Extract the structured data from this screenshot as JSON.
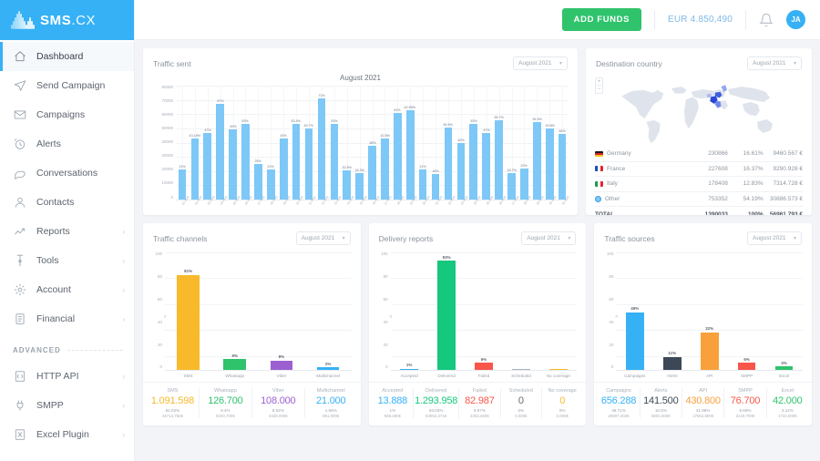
{
  "brand": {
    "name": "SMS",
    "suffix": ".CX"
  },
  "sidebar": {
    "items": [
      {
        "label": "Dashboard",
        "icon": "home-icon",
        "chevron": ""
      },
      {
        "label": "Send Campaign",
        "icon": "send-icon",
        "chevron": ""
      },
      {
        "label": "Campaigns",
        "icon": "envelope-icon",
        "chevron": ""
      },
      {
        "label": "Alerts",
        "icon": "alarm-clock-icon",
        "chevron": ""
      },
      {
        "label": "Conversations",
        "icon": "chat-bubble-icon",
        "chevron": ""
      },
      {
        "label": "Contacts",
        "icon": "user-icon",
        "chevron": ""
      },
      {
        "label": "Reports",
        "icon": "trend-line-icon",
        "chevron": "›"
      },
      {
        "label": "Tools",
        "icon": "wrench-icon",
        "chevron": "›"
      },
      {
        "label": "Account",
        "icon": "gear-icon",
        "chevron": "›"
      },
      {
        "label": "Financial",
        "icon": "document-list-icon",
        "chevron": "›"
      }
    ],
    "section_label": "ADVANCED",
    "advanced_items": [
      {
        "label": "HTTP API",
        "icon": "code-file-icon",
        "chevron": "›"
      },
      {
        "label": "SMPP",
        "icon": "plug-icon",
        "chevron": "›"
      },
      {
        "label": "Excel Plugin",
        "icon": "excel-file-icon",
        "chevron": "›"
      }
    ]
  },
  "topbar": {
    "add_funds_label": "ADD FUNDS",
    "balance": "EUR 4.850,490",
    "bell_icon": "bell-icon",
    "avatar_initials": "JA"
  },
  "period": "August 2021",
  "cards": {
    "traffic_sent": {
      "title": "Traffic sent"
    },
    "destination_country": {
      "title": "Destination country"
    },
    "traffic_channels": {
      "title": "Traffic channels"
    },
    "delivery_reports": {
      "title": "Delivery reports"
    },
    "traffic_sources": {
      "title": "Traffic sources"
    }
  },
  "country_table": {
    "rows": [
      {
        "name": "Germany",
        "flag": "de",
        "count": "230866",
        "pct": "16.61%",
        "amount": "9460.567 €"
      },
      {
        "name": "France",
        "flag": "fr",
        "count": "227608",
        "pct": "16.37%",
        "amount": "9290.928 €"
      },
      {
        "name": "Italy",
        "flag": "it",
        "count": "178408",
        "pct": "12.83%",
        "amount": "7314.728 €"
      },
      {
        "name": "Other",
        "flag": "dot",
        "count": "753352",
        "pct": "54.19%",
        "amount": "30886.573 €"
      }
    ],
    "total": {
      "name": "TOTAL",
      "count": "1390033",
      "pct": "100%",
      "amount": "56961,793 €"
    }
  },
  "chart_data": [
    {
      "type": "bar",
      "name": "traffic-sent",
      "title": "August 2021",
      "xlabel": "",
      "ylabel": "",
      "ylim": [
        0,
        80000
      ],
      "yticks": [
        80000,
        70000,
        60000,
        50000,
        40000,
        30000,
        20000,
        10000,
        0
      ],
      "grid": true,
      "bar_color": "#7dc8f7",
      "categories": [
        "01 Aug",
        "02 Aug",
        "03 Aug",
        "04 Aug",
        "05 Aug",
        "06 Aug",
        "07 Aug",
        "08 Aug",
        "09 Aug",
        "10 Aug",
        "11 Aug",
        "12 Aug",
        "13 Aug",
        "14 Aug",
        "15 Aug",
        "16 Aug",
        "17 Aug",
        "18 Aug",
        "19 Aug",
        "20 Aug",
        "21 Aug",
        "22 Aug",
        "23 Aug",
        "24 Aug",
        "25 Aug",
        "26 Aug",
        "27 Aug",
        "28 Aug",
        "29 Aug",
        "30 Aug",
        "31 Aug"
      ],
      "values": [
        21000,
        43180,
        47000,
        67000,
        49000,
        53000,
        25000,
        21000,
        43000,
        53400,
        49700,
        71000,
        53000,
        20500,
        18300,
        38000,
        42800,
        61000,
        62550,
        21000,
        18000,
        50600,
        40000,
        53000,
        47000,
        55700,
        18700,
        22000,
        54500,
        49800,
        46000
      ],
      "point_labels": [
        "21%",
        "43.18%",
        "47%",
        "67%",
        "49%",
        "53%",
        "25%",
        "21%",
        "43%",
        "53.4%",
        "49.7%",
        "71%",
        "53%",
        "20.5%",
        "18.3%",
        "38%",
        "42.8%",
        "61%",
        "62.55%",
        "21%",
        "18%",
        "50.6%",
        "40%",
        "53%",
        "47%",
        "55.7%",
        "18.7%",
        "22%",
        "54.5%",
        "49.8%",
        "46%"
      ]
    },
    {
      "type": "bar",
      "name": "traffic-channels",
      "title": "Traffic channels",
      "ylabel": "#",
      "ylim": [
        0,
        100
      ],
      "yticks": [
        100,
        80,
        60,
        40,
        20,
        0
      ],
      "categories": [
        "SMS",
        "Whatsapp",
        "Viber",
        "Multichannel"
      ],
      "values": [
        81,
        9,
        8,
        2
      ],
      "point_labels": [
        "81%",
        "9%",
        "8%",
        "2%"
      ],
      "colors": [
        "#f8b92b",
        "#2fc36c",
        "#9b5fd0",
        "#36b1f5"
      ],
      "stats": [
        {
          "name": "SMS",
          "value": "1.091.598",
          "pct": "81.02%",
          "money": "44713,782€",
          "color": "#f8b92b"
        },
        {
          "name": "Whatsapp",
          "value": "126.700",
          "pct": "9.4%",
          "money": "5194,700€",
          "color": "#2fc36c"
        },
        {
          "name": "Viber",
          "value": "108.000",
          "pct": "8.02%",
          "money": "4428,000€",
          "color": "#9b5fd0"
        },
        {
          "name": "Multichannel",
          "value": "21.000",
          "pct": "1.56%",
          "money": "861,000€",
          "color": "#36b1f5"
        }
      ]
    },
    {
      "type": "bar",
      "name": "delivery-reports",
      "title": "Delivery reports",
      "ylabel": "#",
      "ylim": [
        0,
        100
      ],
      "yticks": [
        100,
        80,
        60,
        40,
        20,
        0
      ],
      "categories": [
        "Accepted",
        "Delivered",
        "Failed",
        "Scheduled",
        "No coverage"
      ],
      "values": [
        1,
        93,
        6,
        0,
        0
      ],
      "point_labels": [
        "1%",
        "93%",
        "6%",
        "",
        ""
      ],
      "colors": [
        "#36b1f5",
        "#16c77e",
        "#f8564a",
        "#aab3bd",
        "#f8b92b"
      ],
      "stats": [
        {
          "name": "Accepted",
          "value": "13.888",
          "pct": "1%",
          "money": "569,480€",
          "color": "#36b1f5"
        },
        {
          "name": "Delivered",
          "value": "1.293.958",
          "pct": "93.03%",
          "money": "53052,271€",
          "color": "#16c77e"
        },
        {
          "name": "Failed",
          "value": "82.987",
          "pct": "5.97%",
          "money": "3402,460€",
          "color": "#f8564a"
        },
        {
          "name": "Scheduled",
          "value": "0",
          "pct": "0%",
          "money": "0,000€",
          "color": "#5f6874"
        },
        {
          "name": "No coverage",
          "value": "0",
          "pct": "0%",
          "money": "0,000€",
          "color": "#f8b92b"
        }
      ]
    },
    {
      "type": "bar",
      "name": "traffic-sources",
      "title": "Traffic sources",
      "ylabel": "#",
      "ylim": [
        0,
        100
      ],
      "yticks": [
        100,
        80,
        60,
        40,
        20,
        0
      ],
      "categories": [
        "Campaigns",
        "Alerts",
        "API",
        "SMPP",
        "Excel"
      ],
      "values": [
        49,
        11,
        32,
        6,
        3
      ],
      "point_labels": [
        "49%",
        "11%",
        "32%",
        "6%",
        "3%"
      ],
      "colors": [
        "#36b1f5",
        "#3d4856",
        "#f9a03c",
        "#f8564a",
        "#2fc36c"
      ],
      "stats": [
        {
          "name": "Campaigns",
          "value": "656.288",
          "pct": "48.71%",
          "money": "26907,402€",
          "color": "#36b1f5"
        },
        {
          "name": "Alerts",
          "value": "141.500",
          "pct": "10.5%",
          "money": "5801,500€",
          "color": "#3d4856"
        },
        {
          "name": "API",
          "value": "430.800",
          "pct": "31.98%",
          "money": "17662,800€",
          "color": "#f9a03c"
        },
        {
          "name": "SMPP",
          "value": "76.700",
          "pct": "5.69%",
          "money": "3143,700€",
          "color": "#f8564a"
        },
        {
          "name": "Excel",
          "value": "42.000",
          "pct": "3.12%",
          "money": "1722,000€",
          "color": "#2fc36c"
        }
      ]
    }
  ]
}
